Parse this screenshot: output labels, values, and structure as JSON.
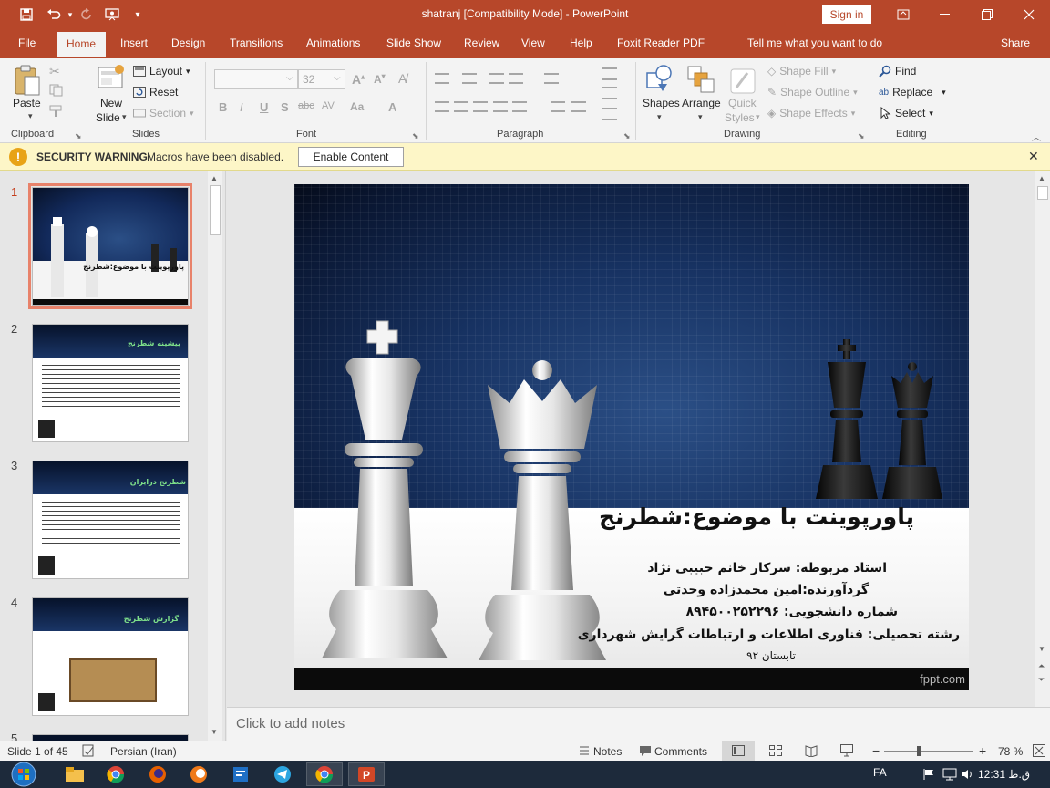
{
  "window": {
    "title": "shatranj [Compatibility Mode]  -  PowerPoint",
    "sign_in": "Sign in"
  },
  "tabs": [
    "File",
    "Home",
    "Insert",
    "Design",
    "Transitions",
    "Animations",
    "Slide Show",
    "Review",
    "View",
    "Help",
    "Foxit Reader PDF"
  ],
  "active_tab": "Home",
  "tell_me": "Tell me what you want to do",
  "share": "Share",
  "ribbon": {
    "clipboard": {
      "label": "Clipboard",
      "paste": "Paste"
    },
    "slides": {
      "label": "Slides",
      "new_slide_1": "New",
      "new_slide_2": "Slide",
      "layout": "Layout",
      "reset": "Reset",
      "section": "Section"
    },
    "font": {
      "label": "Font",
      "font_name": "",
      "font_size": "32"
    },
    "paragraph": {
      "label": "Paragraph"
    },
    "drawing": {
      "label": "Drawing",
      "shapes": "Shapes",
      "arrange": "Arrange",
      "quick_styles_1": "Quick",
      "quick_styles_2": "Styles",
      "shape_fill": "Shape Fill",
      "shape_outline": "Shape Outline",
      "shape_effects": "Shape Effects"
    },
    "editing": {
      "label": "Editing",
      "find": "Find",
      "replace": "Replace",
      "select": "Select"
    }
  },
  "security_bar": {
    "title": "SECURITY WARNING",
    "message": "Macros have been disabled.",
    "button": "Enable Content"
  },
  "thumbnails": [
    {
      "num": "1",
      "title": "پاورپوینت با موضوع:شطرنج"
    },
    {
      "num": "2",
      "title": "پیشینه شطرنج"
    },
    {
      "num": "3",
      "title": "شطرنج درایران"
    },
    {
      "num": "4",
      "title": "گزارش شطرنج"
    },
    {
      "num": "5",
      "title": ""
    }
  ],
  "slide": {
    "title": "پاورپوینت با موضوع:شطرنج",
    "line1": "استاد مربوطه:  سرکار خانم حبیبی نژاد",
    "line2": "گردآورنده:امین محمدزاده وحدتی",
    "line3": "شماره دانشجویی:      ۸۹۴۵۰۰۲۵۲۲۹۶",
    "line4": "رشته تحصیلی:  فناوری اطلاعات و ارتباطات گرایش شهرداری",
    "line5": "تابستان ۹۲",
    "watermark": "fppt.com"
  },
  "notes_placeholder": "Click to add notes",
  "status": {
    "slide_of": "Slide 1 of 45",
    "language": "Persian (Iran)",
    "notes": "Notes",
    "comments": "Comments",
    "zoom": "78 %"
  },
  "taskbar": {
    "lang": "FA",
    "time": "12:31 ق.ظ"
  },
  "colors": {
    "accent": "#b7472a",
    "ribbon_bg": "#f3f3f3",
    "security_bg": "#fdf6c7",
    "thumb_selected": "#e8826a"
  }
}
